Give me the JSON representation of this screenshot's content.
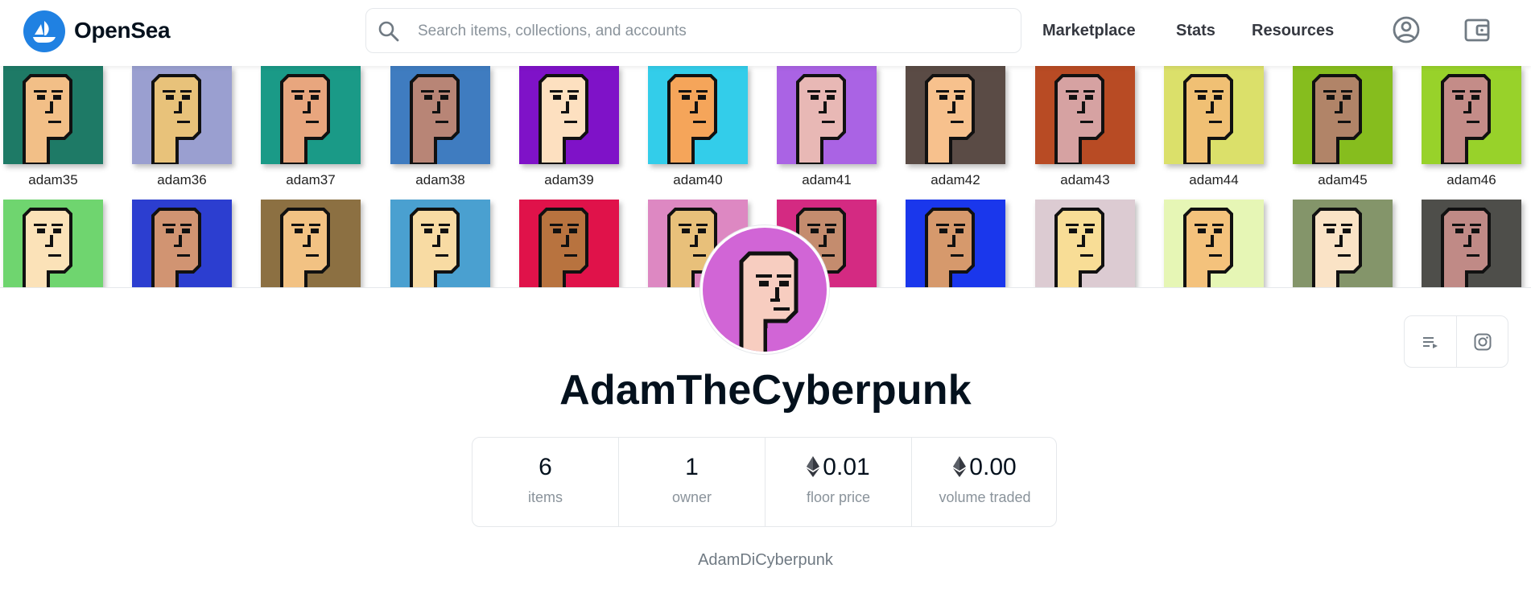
{
  "header": {
    "brand": "OpenSea",
    "search_placeholder": "Search items, collections, and accounts",
    "nav": [
      "Marketplace",
      "Stats",
      "Resources"
    ]
  },
  "banner": {
    "row1": [
      {
        "label": "adam35",
        "bg": "#1e7a66",
        "skin": "#f2bf87"
      },
      {
        "label": "adam36",
        "bg": "#9a9fd0",
        "skin": "#e8c27a"
      },
      {
        "label": "adam37",
        "bg": "#1a9a87",
        "skin": "#e8a67e"
      },
      {
        "label": "adam38",
        "bg": "#3f7cc0",
        "skin": "#b88576"
      },
      {
        "label": "adam39",
        "bg": "#7f12c8",
        "skin": "#fde0c0"
      },
      {
        "label": "adam40",
        "bg": "#33cdea",
        "skin": "#f5a55a"
      },
      {
        "label": "adam41",
        "bg": "#aa63e4",
        "skin": "#e8b8b5"
      },
      {
        "label": "adam42",
        "bg": "#5a4b45",
        "skin": "#f7c18d"
      },
      {
        "label": "adam43",
        "bg": "#b84b24",
        "skin": "#d6a2a2"
      },
      {
        "label": "adam44",
        "bg": "#dbe06a",
        "skin": "#f0c074"
      },
      {
        "label": "adam45",
        "bg": "#86bd1e",
        "skin": "#b18468"
      },
      {
        "label": "adam46",
        "bg": "#98d22a",
        "skin": "#c48c88"
      }
    ],
    "row2": [
      {
        "bg": "#6fd56f",
        "skin": "#fbe2b8"
      },
      {
        "bg": "#2c3ed0",
        "skin": "#d19472"
      },
      {
        "bg": "#8c7042",
        "skin": "#f2c283"
      },
      {
        "bg": "#4aa0d0",
        "skin": "#f8dba3"
      },
      {
        "bg": "#e0124a",
        "skin": "#b8733f"
      },
      {
        "bg": "#dd88c2",
        "skin": "#e8c07a"
      },
      {
        "bg": "#d42a82",
        "skin": "#c48c6e"
      },
      {
        "bg": "#1a37ec",
        "skin": "#d6996c"
      },
      {
        "bg": "#dccbd2",
        "skin": "#f8dd96"
      },
      {
        "bg": "#e6f6b5",
        "skin": "#f4c27c"
      },
      {
        "bg": "#84956a",
        "skin": "#fae3c6"
      },
      {
        "bg": "#4e4e4a",
        "skin": "#c08a86"
      }
    ]
  },
  "profile": {
    "avatar_bg": "#d165d6",
    "name": "AdamTheCyberpunk",
    "handle": "AdamDiCyberpunk"
  },
  "stats": [
    {
      "value": "6",
      "label": "items",
      "eth": false
    },
    {
      "value": "1",
      "label": "owner",
      "eth": false
    },
    {
      "value": "0.01",
      "label": "floor price",
      "eth": true
    },
    {
      "value": "0.00",
      "label": "volume traded",
      "eth": true
    }
  ]
}
